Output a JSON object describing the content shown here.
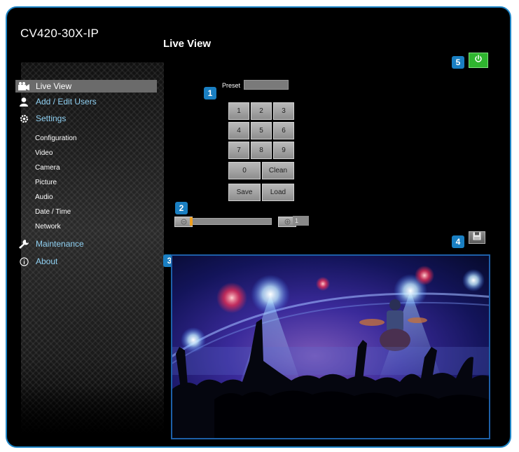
{
  "device": {
    "title": "CV420-30X-IP"
  },
  "page": {
    "title": "Live View"
  },
  "sidebar": {
    "items": [
      {
        "label": "Live View",
        "icon": "camera-icon",
        "active": true
      },
      {
        "label": "Add / Edit Users",
        "icon": "user-icon"
      },
      {
        "label": "Settings",
        "icon": "gear-icon"
      },
      {
        "label": "Maintenance",
        "icon": "wrench-icon"
      },
      {
        "label": "About",
        "icon": "info-icon"
      }
    ],
    "settings_sub": [
      "Configuration",
      "Video",
      "Camera",
      "Picture",
      "Audio",
      "Date / Time",
      "Network"
    ]
  },
  "badges": [
    "1",
    "2",
    "3",
    "4",
    "5"
  ],
  "preset": {
    "label": "Preset",
    "value": "",
    "keys": [
      "1",
      "2",
      "3",
      "4",
      "5",
      "6",
      "7",
      "8",
      "9",
      "0",
      "Clean",
      "Save",
      "Load"
    ]
  },
  "zoom": {
    "value": "1",
    "position": 0.0
  },
  "colors": {
    "accent": "#1a7fc2",
    "power": "#2fb52f",
    "nav_text": "#8fd0f2",
    "active_bg": "#6b6b6b"
  },
  "icons": {
    "snapshot": "save-icon",
    "power": "power-icon",
    "zoom_out": "zoom-out-icon",
    "zoom_in": "zoom-in-icon"
  }
}
